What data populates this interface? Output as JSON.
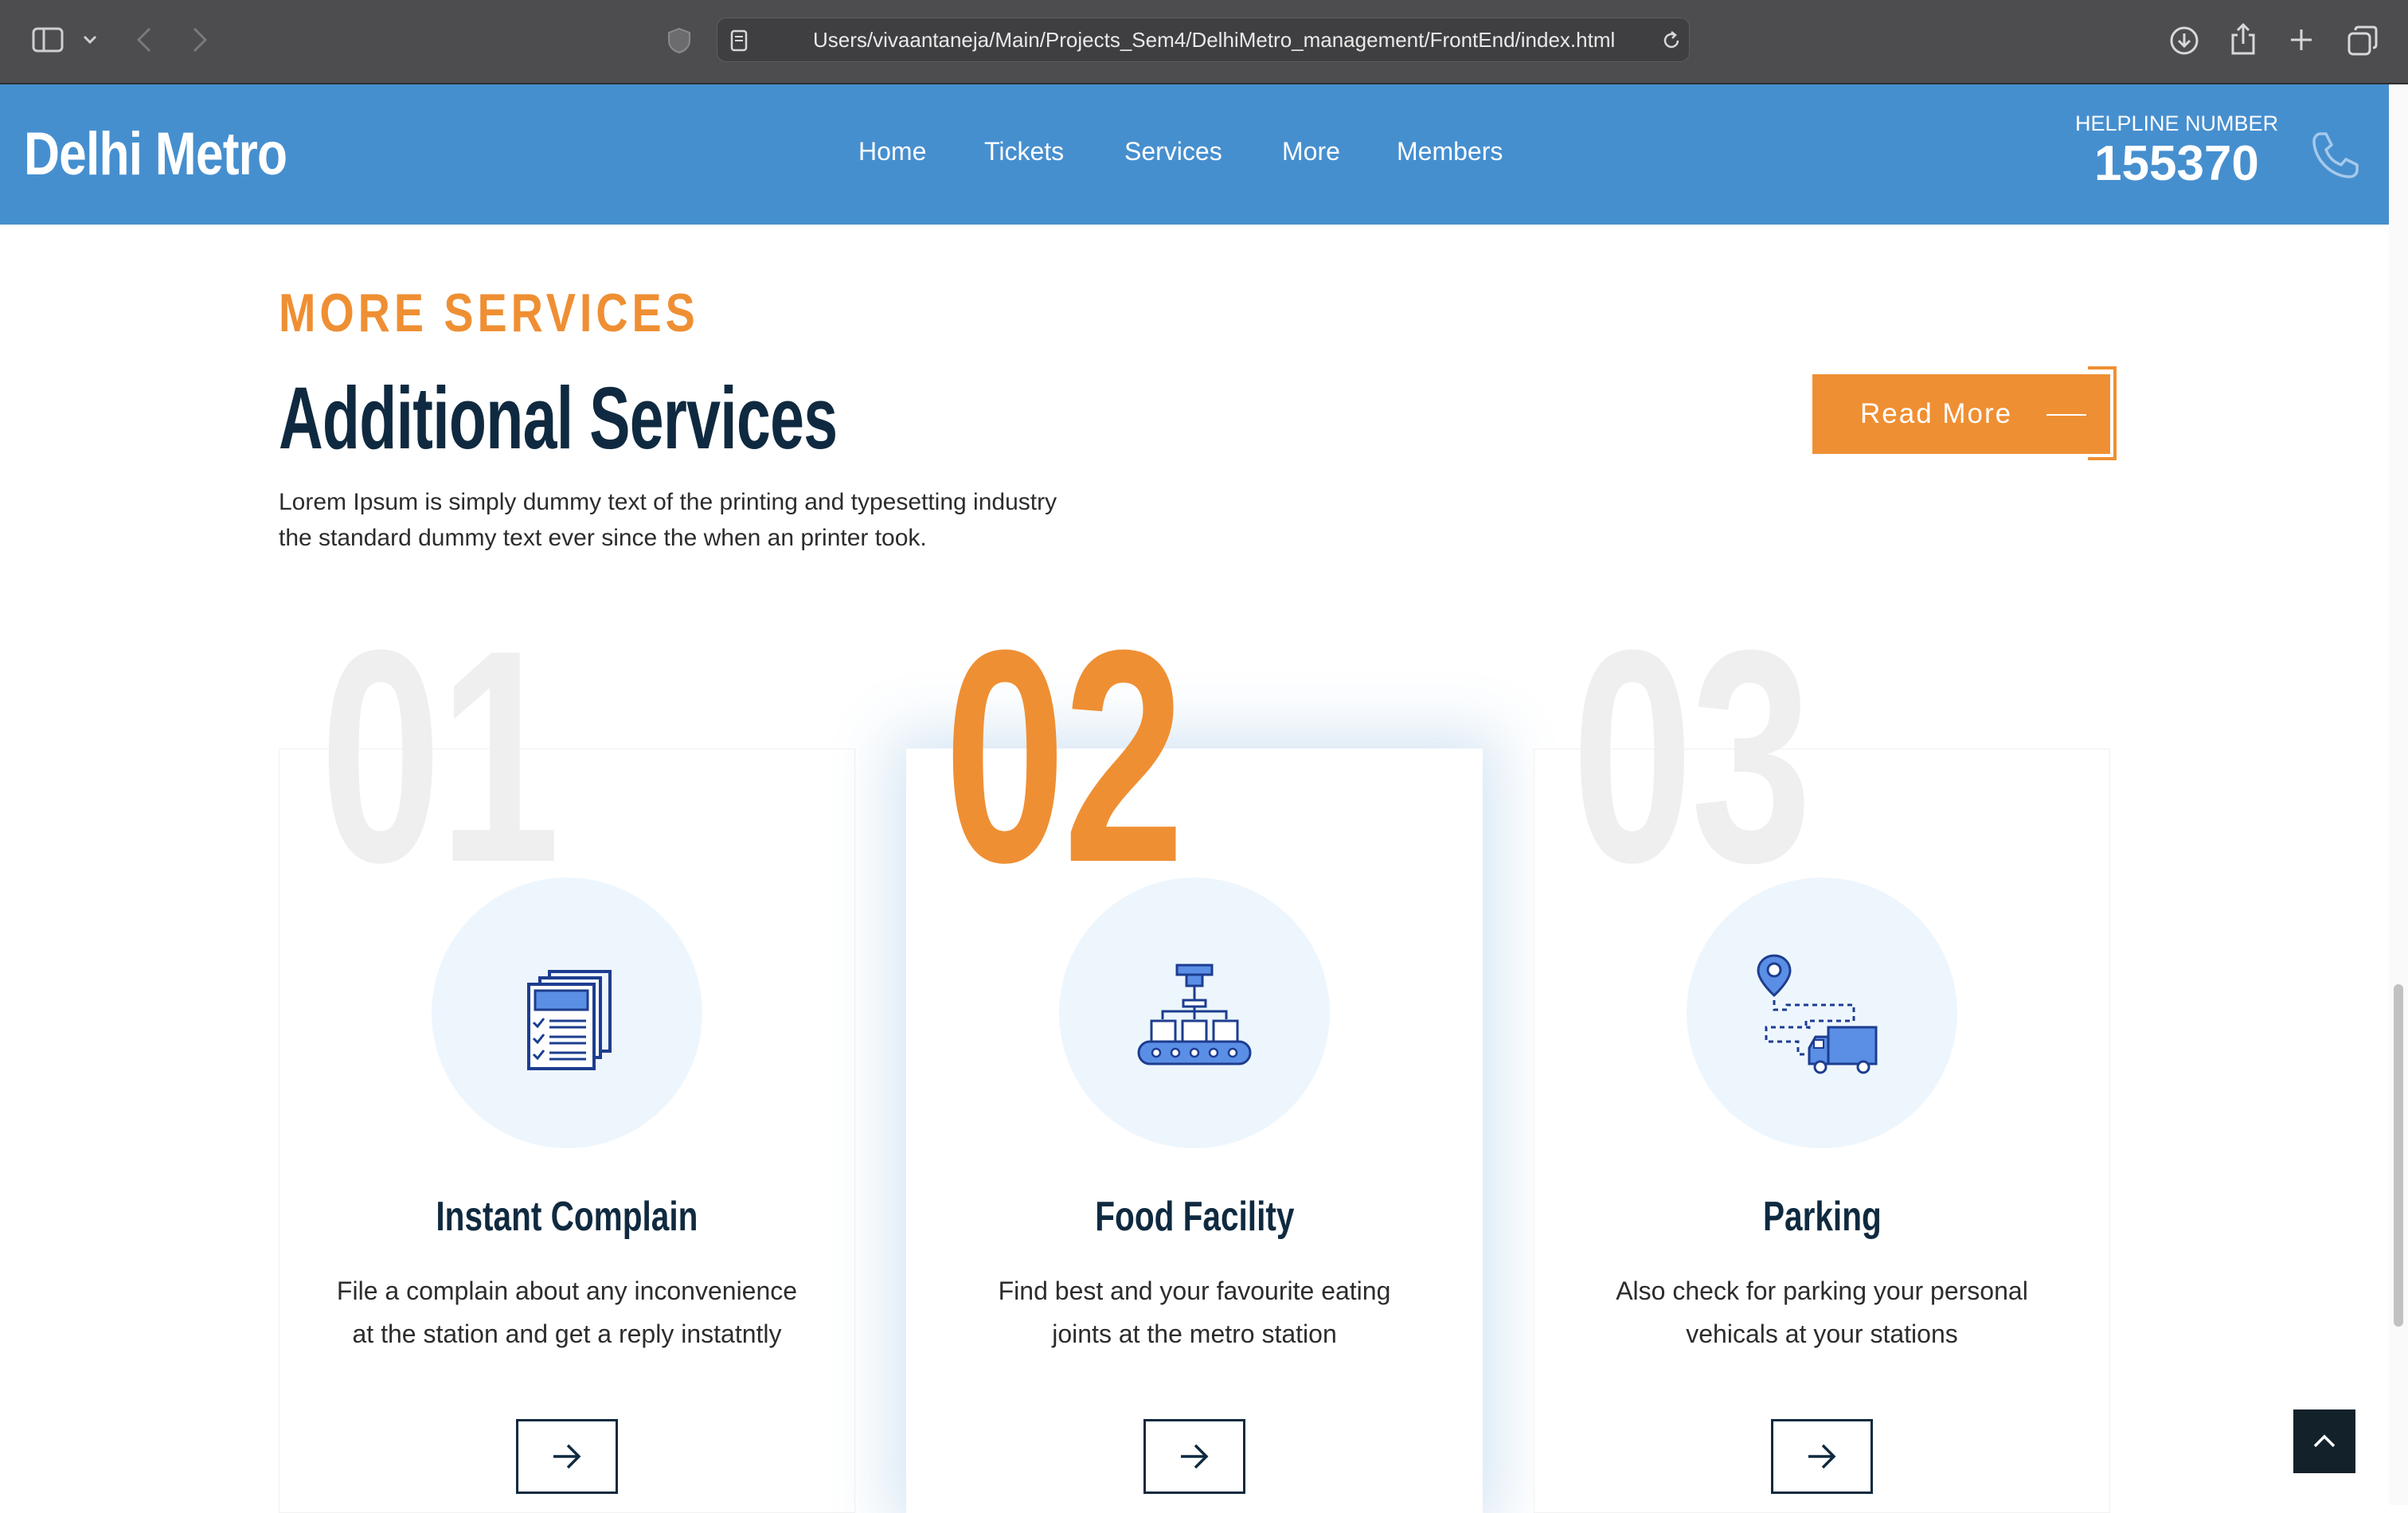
{
  "browser": {
    "url": "Users/vivaantaneja/Main/Projects_Sem4/DelhiMetro_management/FrontEnd/index.html",
    "icons": [
      "sidebar-icon",
      "chevron-down-icon",
      "back-icon",
      "forward-icon",
      "shield-icon",
      "page-icon",
      "reload-icon",
      "download-icon",
      "share-icon",
      "new-tab-icon",
      "tab-overview-icon"
    ]
  },
  "header": {
    "brand": "Delhi Metro",
    "nav": [
      "Home",
      "Tickets",
      "Services",
      "More",
      "Members"
    ],
    "helpline_label": "HELPLINE NUMBER",
    "helpline_number": "155370",
    "bg_color": "#468fcf"
  },
  "section": {
    "eyebrow": "MORE SERVICES",
    "title": "Additional Services",
    "description_lines": [
      "Lorem Ipsum is simply dummy text of the printing and typesetting industry",
      "the standard dummy text ever since the when an printer took."
    ],
    "read_more": "Read More",
    "accent_color": "#ef8f33",
    "title_color": "#0f2a40"
  },
  "cards": [
    {
      "number": "01",
      "icon": "document-checklist-icon",
      "title": "Instant Complain",
      "text_lines": [
        "File a complain about any inconvenience",
        "at the station and get a reply instatntly"
      ],
      "highlighted": false
    },
    {
      "number": "02",
      "icon": "conveyor-belt-icon",
      "title": "Food Facility",
      "text_lines": [
        "Find best and your favourite eating",
        "joints at the metro station"
      ],
      "highlighted": true
    },
    {
      "number": "03",
      "icon": "parking-route-truck-icon",
      "title": "Parking",
      "text_lines": [
        "Also check for parking your personal",
        "vehicals at your stations"
      ],
      "highlighted": false
    }
  ]
}
